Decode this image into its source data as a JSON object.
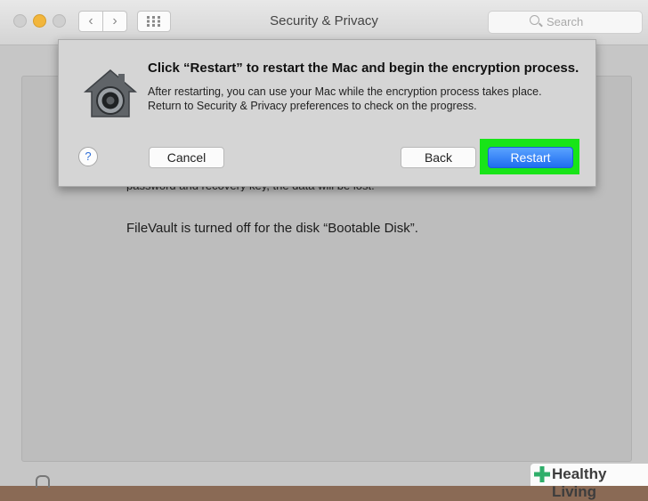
{
  "window": {
    "title": "Security & Privacy"
  },
  "toolbar": {
    "back_glyph": "‹",
    "forward_glyph": "›",
    "grid_glyph": "⋮⋮⋮"
  },
  "search": {
    "placeholder": "Search"
  },
  "dialog": {
    "heading": "Click “Restart” to restart the Mac and begin the encryption process.",
    "body_line1": "After restarting, you can use your Mac while the encryption process takes place.",
    "body_line2": "Return to Security & Privacy preferences to check on the progress.",
    "help_label": "?",
    "cancel_label": "Cancel",
    "back_label": "Back",
    "restart_label": "Restart",
    "icon": "filevault-lock-icon"
  },
  "background_panel": {
    "partial_text": "password and recovery key, the data will be lost.",
    "filevault_status": "FileVault is turned off for the disk “Bootable Disk”."
  },
  "watermark": {
    "text": "Healthy Living"
  },
  "colors": {
    "highlight": "#18e418",
    "accent": "#1f6ef0",
    "minimize": "#f2b63c"
  }
}
